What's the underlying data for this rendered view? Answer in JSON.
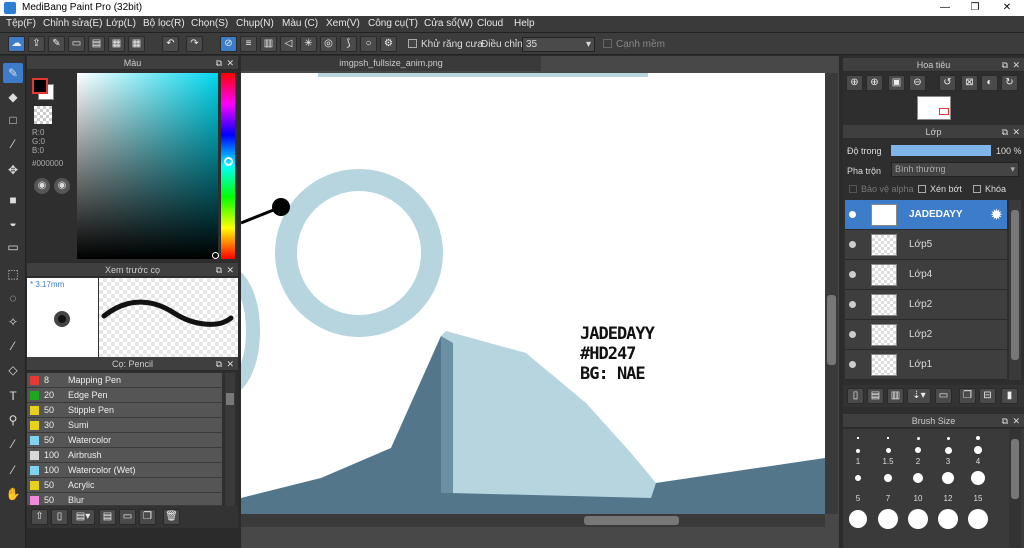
{
  "app": {
    "title": "MediBang Paint Pro (32bit)"
  },
  "menu": [
    "Tệp(F)",
    "Chỉnh sửa(E)",
    "Lớp(L)",
    "Bộ lọc(R)",
    "Chọn(S)",
    "Chụp(N)",
    "Màu (C)",
    "Xem(V)",
    "Công cụ(T)",
    "Cửa sổ(W)",
    "Cloud",
    "Help"
  ],
  "toolbar": {
    "antialias_label": "Khử răng cưa",
    "adjust_label": "Điều chỉnh",
    "adjust_value": "35",
    "smooth_label": "Cạnh mềm"
  },
  "color_panel": {
    "title": "Màu",
    "r": "R:0",
    "g": "G:0",
    "b": "B:0",
    "hex": "#000000"
  },
  "brush_preview": {
    "title": "Xem trước cọ",
    "size": "3.17mm"
  },
  "brush_list": {
    "title": "Cọ: Pencil",
    "items": [
      {
        "size": "8",
        "name": "Mapping Pen",
        "color": "#e53935"
      },
      {
        "size": "20",
        "name": "Edge Pen",
        "color": "#1fa51f"
      },
      {
        "size": "50",
        "name": "Stipple Pen",
        "color": "#e6d21a"
      },
      {
        "size": "30",
        "name": "Sumi",
        "color": "#e6d21a"
      },
      {
        "size": "50",
        "name": "Watercolor",
        "color": "#7fd3f0"
      },
      {
        "size": "100",
        "name": "Airbrush",
        "color": "#d8d8d8"
      },
      {
        "size": "100",
        "name": "Watercolor (Wet)",
        "color": "#7fd3f0"
      },
      {
        "size": "50",
        "name": "Acrylic",
        "color": "#e6d21a"
      },
      {
        "size": "50",
        "name": "Blur",
        "color": "#f08ad8"
      }
    ]
  },
  "canvas": {
    "tab": "imgpsh_fullsize_anim.png",
    "text_lines": [
      "JADEDAYY",
      "#HD247",
      "BG: NAE"
    ]
  },
  "navigator": {
    "title": "Hoa tiêu"
  },
  "layers": {
    "title": "Lớp",
    "opacity_label": "Độ trong",
    "opacity_value": "100 %",
    "blend_label": "Pha trộn",
    "blend_value": "Bình thường",
    "protect_alpha": "Bảo vệ alpha",
    "clipping": "Xén bớt",
    "lock": "Khóa",
    "items": [
      {
        "name": "JADEDAYY",
        "selected": true
      },
      {
        "name": "Lớp5"
      },
      {
        "name": "Lớp4"
      },
      {
        "name": "Lớp2"
      },
      {
        "name": "Lớp2"
      },
      {
        "name": "Lớp1"
      }
    ]
  },
  "brush_size": {
    "title": "Brush Size",
    "row1": [
      "1",
      "1.5",
      "2",
      "3",
      "4"
    ],
    "row2": [
      "5",
      "7",
      "10",
      "12",
      "15"
    ]
  }
}
